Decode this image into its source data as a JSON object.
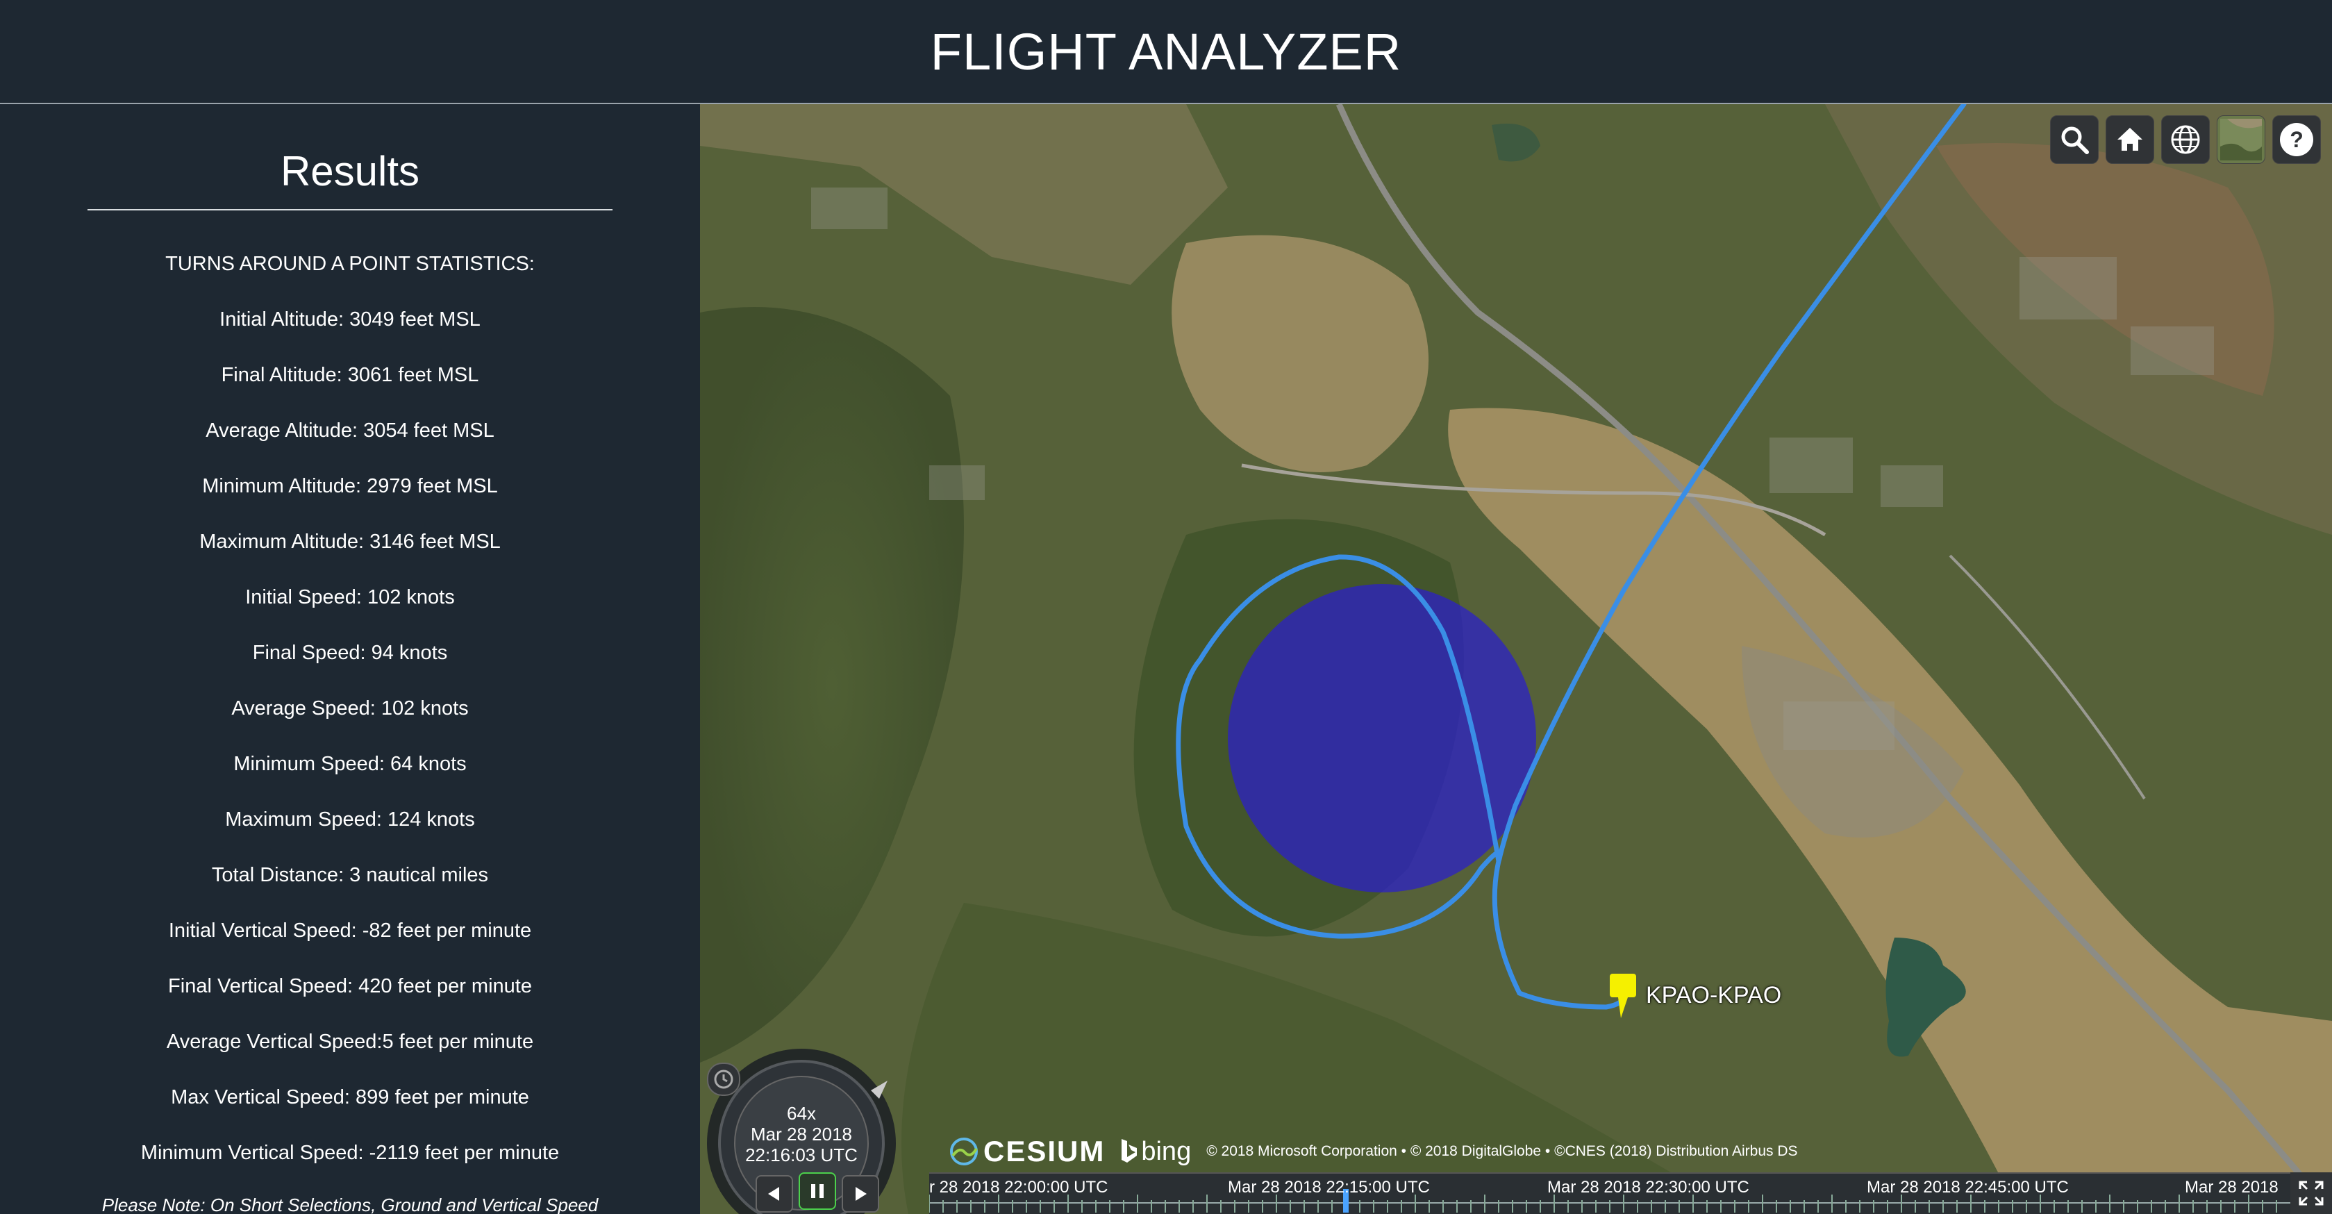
{
  "header": {
    "title": "FLIGHT ANALYZER"
  },
  "sidebar": {
    "title": "Results",
    "stats": [
      "TURNS AROUND A POINT STATISTICS:",
      "Initial Altitude: 3049 feet MSL",
      "Final Altitude: 3061 feet MSL",
      "Average Altitude: 3054 feet MSL",
      "Minimum Altitude: 2979 feet MSL",
      "Maximum Altitude: 3146 feet MSL",
      "Initial Speed: 102 knots",
      "Final Speed: 94 knots",
      "Average Speed: 102 knots",
      "Minimum Speed: 64 knots",
      "Maximum Speed: 124 knots",
      "Total Distance: 3 nautical miles",
      "Initial Vertical Speed: -82 feet per minute",
      "Final Vertical Speed: 420 feet per minute",
      "Average Vertical Speed:5 feet per minute",
      "Max Vertical Speed: 899 feet per minute",
      "Minimum Vertical Speed: -2119 feet per minute"
    ],
    "note": "Please Note: On Short Selections, Ground and Vertical Speed"
  },
  "map": {
    "toolbar": [
      "search-icon",
      "home-icon",
      "globe-icon",
      "imagery-icon",
      "help-icon"
    ],
    "flight_label": "KPAO-KPAO",
    "track_color": "#3a8ee6",
    "circle_color": "#2a1cd0",
    "marker_color": "#f5f000"
  },
  "credits": {
    "cesium": "CESIUM",
    "bing": "bing",
    "text": "© 2018 Microsoft Corporation • © 2018 DigitalGlobe • ©CNES (2018) Distribution Airbus DS"
  },
  "animation": {
    "multiplier": "64x",
    "date": "Mar 28 2018",
    "time": "22:16:03 UTC"
  },
  "timeline": {
    "labels": [
      "r 28 2018 22:00:00 UTC",
      "Mar 28 2018 22:15:00 UTC",
      "Mar 28 2018 22:30:00 UTC",
      "Mar 28 2018 22:45:00 UTC",
      "Mar 28 2018"
    ]
  }
}
